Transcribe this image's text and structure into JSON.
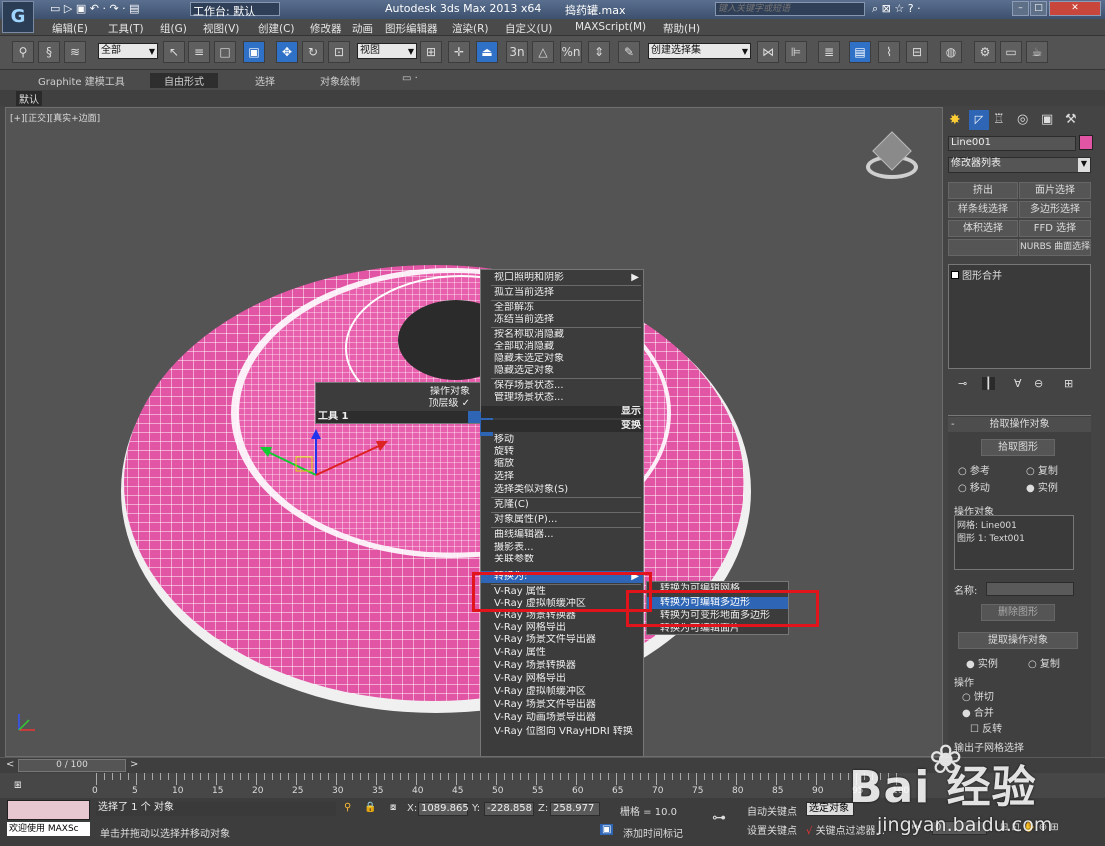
{
  "titlebar": {
    "workspace": "工作台: 默认",
    "app_title": "Autodesk 3ds Max  2013 x64",
    "file_name": "捣药罐.max",
    "search_placeholder": "键入关键字或短语"
  },
  "menu": [
    "编辑(E)",
    "工具(T)",
    "组(G)",
    "视图(V)",
    "创建(C)",
    "修改器",
    "动画",
    "图形编辑器",
    "渲染(R)",
    "自定义(U)",
    "MAXScript(M)",
    "帮助(H)"
  ],
  "toolbar": {
    "filter_value": "全部",
    "ref_coord_value": "视图",
    "selection_set_value": "创建选择集",
    "snap_labels": [
      "3n",
      "%n"
    ]
  },
  "ribbon": {
    "tabs": [
      "Graphite 建模工具",
      "自由形式",
      "选择",
      "对象绘制"
    ],
    "subtab": "默认"
  },
  "viewport": {
    "label": "[+][正交][真实+边面]"
  },
  "quad_left": {
    "items": [
      "操作对象",
      "顶层级"
    ],
    "section": "工具 1"
  },
  "quad_right": {
    "section_top": "显示",
    "section_bottom": "变换"
  },
  "context_menu": {
    "items": [
      "视口照明和阴影",
      "孤立当前选择",
      "全部解冻",
      "冻结当前选择",
      "按名称取消隐藏",
      "全部取消隐藏",
      "隐藏未选定对象",
      "隐藏选定对象",
      "保存场景状态...",
      "管理场景状态...",
      "移动",
      "旋转",
      "缩放",
      "选择",
      "选择类似对象(S)",
      "克隆(C)",
      "对象属性(P)...",
      "曲线编辑器...",
      "摄影表...",
      "关联参数",
      "转换为:",
      "V-Ray 属性",
      "V-Ray 虚拟帧缓冲区",
      "V-Ray 场景转换器",
      "V-Ray 网格导出",
      "V-Ray 场景文件导出器",
      "V-Ray 属性",
      "V-Ray 场景转换器",
      "V-Ray 网格导出",
      "V-Ray 虚拟帧缓冲区",
      "V-Ray 场景文件导出器",
      "V-Ray 动画场景导出器",
      "V-Ray 位图向 VRayHDRI 转换"
    ]
  },
  "submenu": {
    "items": [
      "转换为可编辑网格",
      "转换为可编辑多边形",
      "转换为可变形地面多边形",
      "转换为可编辑面片"
    ]
  },
  "command_panel": {
    "object_name": "Line001",
    "modifier_list": "修改器列表",
    "buttons": [
      "挤出",
      "面片选择",
      "样条线选择",
      "多边形选择",
      "体积选择",
      "FFD 选择",
      "NURBS 曲面选择"
    ],
    "stack_item": "图形合并",
    "rollout_title": "拾取操作对象",
    "pick_button": "拾取图形",
    "radios": [
      "参考",
      "复制",
      "移动",
      "实例"
    ],
    "operands_title": "操作对象",
    "operands": [
      "网格: Line001",
      "图形 1: Text001"
    ],
    "name_label": "名称:",
    "delete_button": "删除图形",
    "extract_button": "提取操作对象",
    "extract_radios": [
      "实例",
      "复制"
    ],
    "operation_title": "操作",
    "operation_radios": [
      "饼切",
      "合并"
    ],
    "invert_label": "反转",
    "output_title": "输出子网格选择"
  },
  "timeline": {
    "frame": "0 / 100",
    "ticks": [
      "0",
      "5",
      "10",
      "15",
      "20",
      "25",
      "30",
      "35",
      "40",
      "45",
      "50",
      "55",
      "60",
      "65",
      "70",
      "75",
      "80",
      "85",
      "90",
      "95",
      "100"
    ]
  },
  "status": {
    "selected": "选择了 1 个 对象",
    "hint": "单击并拖动以选择并移动对象",
    "welcome": "欢迎使用 MAXSc",
    "x_label": "X:",
    "x_value": "1089.865",
    "y_label": "Y:",
    "y_value": "-228.858",
    "z_label": "Z:",
    "z_value": "258.977",
    "grid": "栅格 = 10.0",
    "add_time_tag": "添加时间标记",
    "auto_key": "自动关键点",
    "set_key": "设置关键点",
    "selected_object": "选定对象",
    "key_filter": "关键点过滤器...",
    "frame_field": "0"
  },
  "watermark": {
    "text": "Bai  经验",
    "url": "jingyan.baidu.com"
  },
  "colors": {
    "torus": "#e255a4",
    "highlight": "#2e66b5",
    "callout": "#e0141a"
  }
}
